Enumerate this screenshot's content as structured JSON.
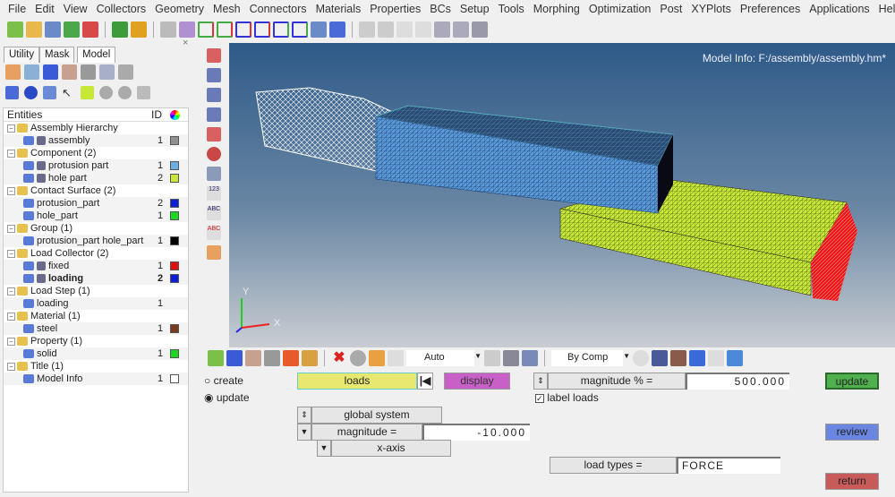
{
  "menu": [
    "File",
    "Edit",
    "View",
    "Collectors",
    "Geometry",
    "Mesh",
    "Connectors",
    "Materials",
    "Properties",
    "BCs",
    "Setup",
    "Tools",
    "Morphing",
    "Optimization",
    "Post",
    "XYPlots",
    "Preferences",
    "Applications",
    "Help"
  ],
  "tabs": [
    "Utility",
    "Mask",
    "Model"
  ],
  "tree": {
    "header": {
      "title": "Entities",
      "id": "ID"
    },
    "rows": [
      {
        "label": "Assembly Hierarchy",
        "level": 0,
        "icon": "assembly-folder-icon"
      },
      {
        "label": "assembly",
        "level": 1,
        "id": "1",
        "color": "#909090",
        "icon": "assembly-icon"
      },
      {
        "label": "Component (2)",
        "level": 0,
        "icon": "component-folder-icon"
      },
      {
        "label": "protusion part",
        "level": 1,
        "id": "1",
        "color": "#6aaee6",
        "icon": "component-icon"
      },
      {
        "label": "hole part",
        "level": 1,
        "id": "2",
        "color": "#c8e838",
        "icon": "component-icon"
      },
      {
        "label": "Contact Surface (2)",
        "level": 0,
        "icon": "contact-folder-icon"
      },
      {
        "label": "protusion_part",
        "level": 1,
        "id": "2",
        "color": "#0a1ed6",
        "icon": "contact-icon"
      },
      {
        "label": "hole_part",
        "level": 1,
        "id": "1",
        "color": "#1ed81e",
        "icon": "contact-icon"
      },
      {
        "label": "Group (1)",
        "level": 0,
        "icon": "group-folder-icon"
      },
      {
        "label": "protusion_part hole_part",
        "level": 1,
        "id": "1",
        "color": "#000000",
        "icon": "group-icon"
      },
      {
        "label": "Load Collector (2)",
        "level": 0,
        "icon": "load-collector-folder-icon"
      },
      {
        "label": "fixed",
        "level": 1,
        "id": "1",
        "color": "#e01010",
        "icon": "load-collector-icon"
      },
      {
        "label": "loading",
        "level": 1,
        "id": "2",
        "color": "#0a1ed6",
        "bold": true,
        "icon": "load-collector-icon"
      },
      {
        "label": "Load Step (1)",
        "level": 0,
        "icon": "load-step-folder-icon"
      },
      {
        "label": "loading",
        "level": 1,
        "id": "1",
        "icon": "load-step-icon"
      },
      {
        "label": "Material (1)",
        "level": 0,
        "icon": "material-folder-icon"
      },
      {
        "label": "steel",
        "level": 1,
        "id": "1",
        "color": "#7a3a1e",
        "icon": "material-icon"
      },
      {
        "label": "Property (1)",
        "level": 0,
        "icon": "property-folder-icon"
      },
      {
        "label": "solid",
        "level": 1,
        "id": "1",
        "color": "#1ed81e",
        "icon": "property-icon"
      },
      {
        "label": "Title (1)",
        "level": 0,
        "icon": "title-folder-icon"
      },
      {
        "label": "Model Info",
        "level": 1,
        "id": "1",
        "color": "#ffffff",
        "icon": "title-icon"
      }
    ]
  },
  "viewport": {
    "model_info": "Model Info: F:/assembly/assembly.hm*",
    "triad": {
      "y": "Y",
      "x": "X"
    }
  },
  "btoolbar": {
    "auto": "Auto",
    "bycomp": "By Comp"
  },
  "panel": {
    "create": "create",
    "update_radio": "update",
    "loads": "loads",
    "display": "display",
    "magnitude_pct_label": "magnitude % =",
    "magnitude_pct": "500.000",
    "label_loads": "label loads",
    "label_loads_checked": true,
    "global_system": "global system",
    "magnitude_label": "magnitude =",
    "magnitude": "-10.000",
    "xaxis": "x-axis",
    "load_types_label": "load types =",
    "load_types": "FORCE",
    "update": "update",
    "review": "review",
    "return": "return",
    "selected_mode": "update"
  }
}
